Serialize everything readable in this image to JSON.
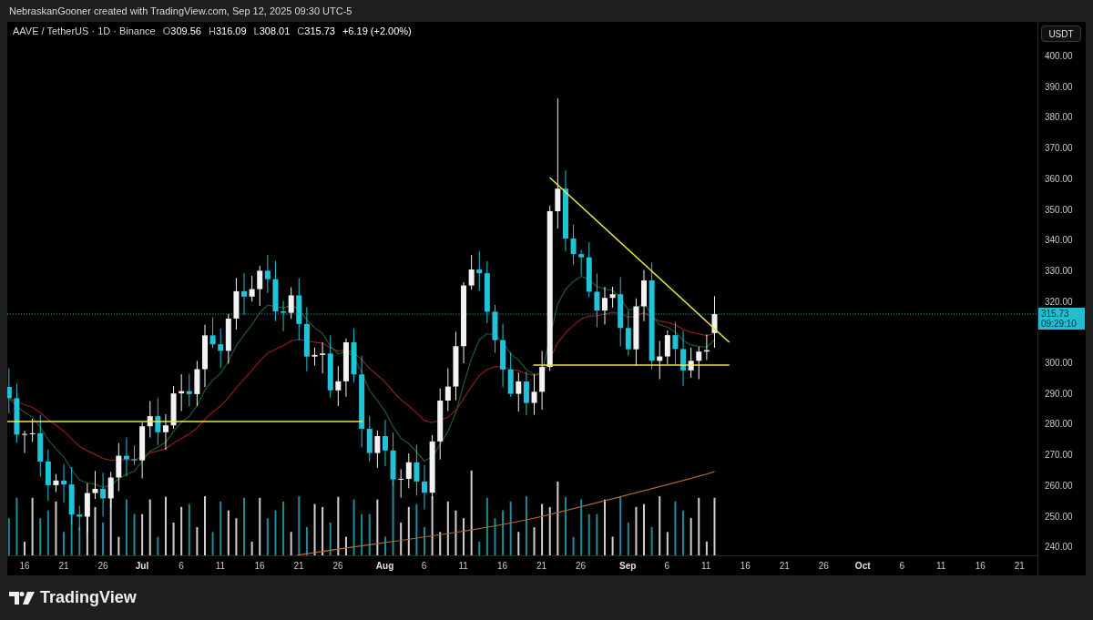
{
  "caption": "NebraskanGooner created with TradingView.com, Sep 12, 2025 09:30 UTC-5",
  "legend": {
    "symbol": "AAVE / TetherUS · 1D · Binance",
    "ohlc": [
      {
        "label": "O",
        "value": "309.56"
      },
      {
        "label": "H",
        "value": "316.09"
      },
      {
        "label": "L",
        "value": "308.01"
      },
      {
        "label": "C",
        "value": "315.73"
      }
    ],
    "change": "+6.19 (+2.00%)"
  },
  "price_axis": {
    "currency": "USDT",
    "labels": [
      "400.00",
      "390.00",
      "380.00",
      "370.00",
      "360.00",
      "350.00",
      "340.00",
      "330.00",
      "320.00",
      "300.00",
      "290.00",
      "280.00",
      "270.00",
      "260.00",
      "250.00",
      "240.00"
    ],
    "last_price": "315.73",
    "countdown": "09:29:10"
  },
  "time_axis": {
    "labels": [
      {
        "text": "16",
        "kind": "day"
      },
      {
        "text": "21",
        "kind": "day"
      },
      {
        "text": "26",
        "kind": "day"
      },
      {
        "text": "Jul",
        "kind": "month"
      },
      {
        "text": "6",
        "kind": "day"
      },
      {
        "text": "11",
        "kind": "day"
      },
      {
        "text": "16",
        "kind": "day"
      },
      {
        "text": "21",
        "kind": "day"
      },
      {
        "text": "26",
        "kind": "day"
      },
      {
        "text": "Aug",
        "kind": "month"
      },
      {
        "text": "6",
        "kind": "day"
      },
      {
        "text": "11",
        "kind": "day"
      },
      {
        "text": "16",
        "kind": "day"
      },
      {
        "text": "21",
        "kind": "day"
      },
      {
        "text": "26",
        "kind": "day"
      },
      {
        "text": "Sep",
        "kind": "month"
      },
      {
        "text": "6",
        "kind": "day"
      },
      {
        "text": "11",
        "kind": "day"
      },
      {
        "text": "16",
        "kind": "day"
      },
      {
        "text": "21",
        "kind": "day"
      },
      {
        "text": "26",
        "kind": "day"
      },
      {
        "text": "Oct",
        "kind": "month"
      },
      {
        "text": "6",
        "kind": "day"
      },
      {
        "text": "11",
        "kind": "day"
      },
      {
        "text": "16",
        "kind": "day"
      },
      {
        "text": "21",
        "kind": "day"
      }
    ]
  },
  "footer": {
    "logo": "TradingView"
  }
}
